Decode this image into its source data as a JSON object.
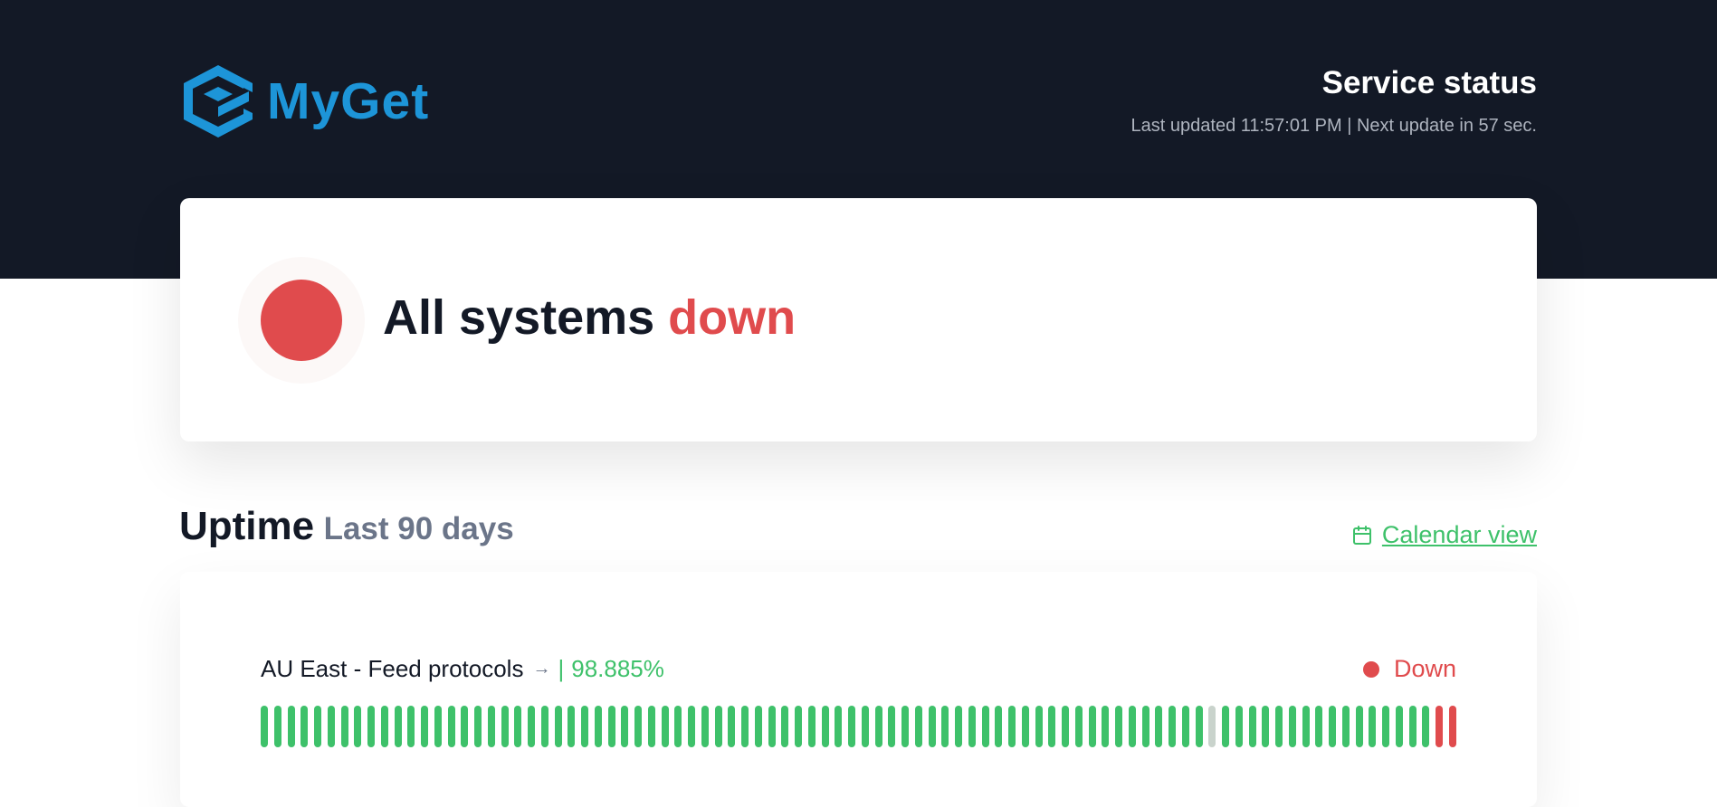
{
  "header": {
    "logo_text": "MyGet",
    "title": "Service status",
    "last_updated": "Last updated 11:57:01 PM | Next update in 57 sec."
  },
  "overall": {
    "text_prefix": "All systems ",
    "text_status": "down",
    "status_color": "#e04b4d"
  },
  "uptime": {
    "title": "Uptime",
    "range_label": "Last 90 days",
    "calendar_link": "Calendar view",
    "calendar_icon": "calendar-icon",
    "monitors": [
      {
        "name": "AU East - Feed protocols",
        "arrow_icon": "arrow-right-icon",
        "separator": "|",
        "uptime_pct": "98.885%",
        "status_label": "Down",
        "status_color": "#e04b4d",
        "days": [
          "up",
          "up",
          "up",
          "up",
          "up",
          "up",
          "up",
          "up",
          "up",
          "up",
          "up",
          "up",
          "up",
          "up",
          "up",
          "up",
          "up",
          "up",
          "up",
          "up",
          "up",
          "up",
          "up",
          "up",
          "up",
          "up",
          "up",
          "up",
          "up",
          "up",
          "up",
          "up",
          "up",
          "up",
          "up",
          "up",
          "up",
          "up",
          "up",
          "up",
          "up",
          "up",
          "up",
          "up",
          "up",
          "up",
          "up",
          "up",
          "up",
          "up",
          "up",
          "up",
          "up",
          "up",
          "up",
          "up",
          "up",
          "up",
          "up",
          "up",
          "up",
          "up",
          "up",
          "up",
          "up",
          "up",
          "up",
          "up",
          "up",
          "up",
          "up",
          "nodata",
          "up",
          "up",
          "up",
          "up",
          "up",
          "up",
          "up",
          "up",
          "up",
          "up",
          "up",
          "up",
          "up",
          "up",
          "up",
          "up",
          "down",
          "down"
        ]
      }
    ]
  },
  "colors": {
    "header_bg": "#131926",
    "accent_green": "#3ec16a",
    "down_red": "#e04b4d",
    "nodata_gray": "#c9d3cc",
    "logo_blue": "#1d95d8"
  }
}
